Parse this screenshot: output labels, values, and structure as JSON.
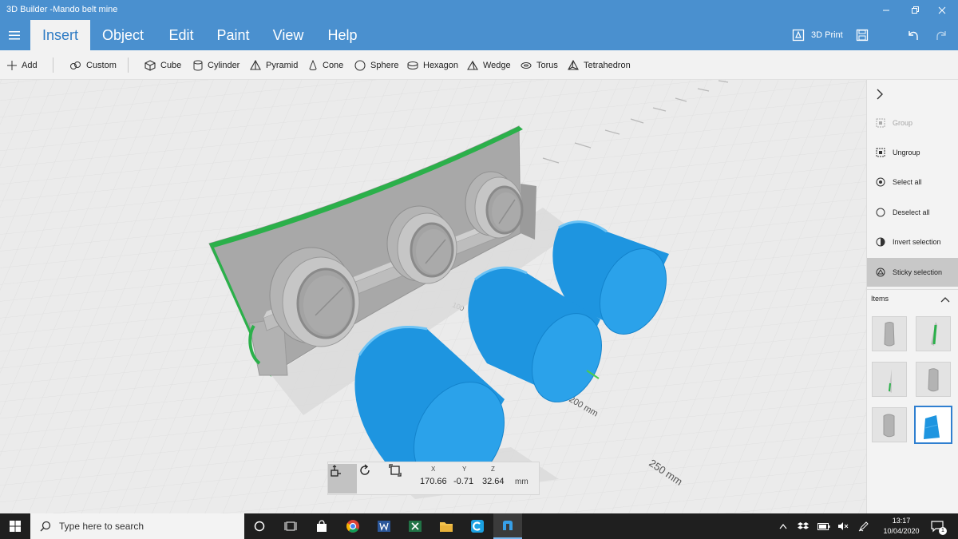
{
  "window": {
    "title": "3D Builder -Mando belt mine"
  },
  "tabs": [
    "Insert",
    "Object",
    "Edit",
    "Paint",
    "View",
    "Help"
  ],
  "ribbon": {
    "print_label": "3D Print"
  },
  "toolbar": {
    "add_label": "Add",
    "custom_label": "Custom",
    "shapes": [
      "Cube",
      "Cylinder",
      "Pyramid",
      "Cone",
      "Sphere",
      "Hexagon",
      "Wedge",
      "Torus",
      "Tetrahedron"
    ]
  },
  "viewport": {
    "ruler": {
      "label_200": "200 mm",
      "label_250": "250 mm",
      "label_100": "100"
    },
    "colors": {
      "selected": "#1e95e0",
      "model": "#a8a8a8",
      "edge": "#2bb04a",
      "floor": "#ededed"
    }
  },
  "coords": {
    "x_label": "X",
    "y_label": "Y",
    "z_label": "Z",
    "x_value": "170.66",
    "y_value": "-0.71",
    "z_value": "32.64",
    "unit": "mm"
  },
  "panel": {
    "group": "Group",
    "ungroup": "Ungroup",
    "select_all": "Select all",
    "deselect_all": "Deselect all",
    "invert_selection": "Invert selection",
    "sticky_selection": "Sticky selection",
    "items_label": "Items"
  },
  "taskbar": {
    "search_placeholder": "Type here to search",
    "time": "13:17",
    "date": "10/04/2020",
    "notification_count": "1"
  }
}
